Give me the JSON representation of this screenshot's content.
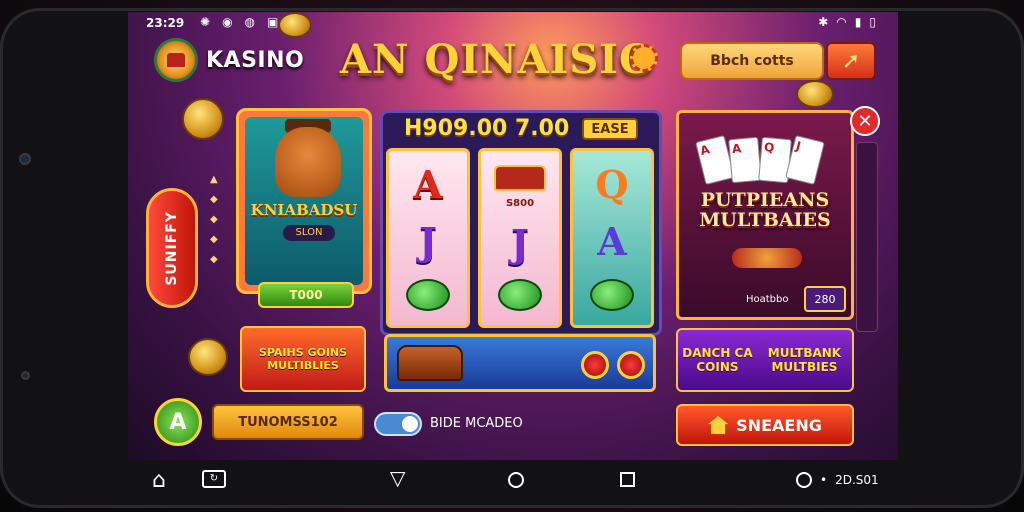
{
  "status_bar": {
    "time": "23:29",
    "left_icons": [
      "settings-icon",
      "signal-icon",
      "app-icon",
      "tv-icon"
    ],
    "right_icons": [
      "bluetooth-icon",
      "wifi-icon",
      "signal-bars-icon",
      "battery-icon"
    ]
  },
  "header": {
    "logo_text": "KASINO",
    "title": "AN QINAISIO",
    "top_button_label": "Bbch cotts"
  },
  "side_pill": {
    "label": "SUNIFFY"
  },
  "left_game": {
    "name": "KNIABADSU",
    "subtitle": "SLON",
    "amount_label": "T000"
  },
  "left_promo": {
    "label": "SPAIHS GOINS MULTIBLIES"
  },
  "reels": {
    "jackpot": "H909.00 7.00",
    "base_tag": "EASE",
    "reel1": [
      "A",
      "J"
    ],
    "reel2": [
      "J"
    ],
    "reel3": [
      "Q",
      "A"
    ],
    "chest_label": "S800"
  },
  "right_game": {
    "name_line1": "PUTPIEANS",
    "name_line2": "MULTBAIES",
    "small_label": "Hoatbbo",
    "badge": "280",
    "card_values": [
      "A",
      "A",
      "Q",
      "J"
    ]
  },
  "right_promo": {
    "label_left": "DANCH CA COINS",
    "label_right": "MULTBANK MULTBIES"
  },
  "bottom_bar": {
    "left_coin_letter": "A",
    "left_button_label": "TUNOMSS102",
    "toggle_label": "BIDE MCADEO",
    "right_button_label": "SNEAENG"
  },
  "nav_bar": {
    "right_text": "2D.S01"
  },
  "colors": {
    "title_gold": "#ffd23a",
    "primary_red": "#e22a2a",
    "accent_orange": "#ffc23a",
    "green_button": "#2f8a10",
    "purple_panel": "#4a0a8a"
  }
}
